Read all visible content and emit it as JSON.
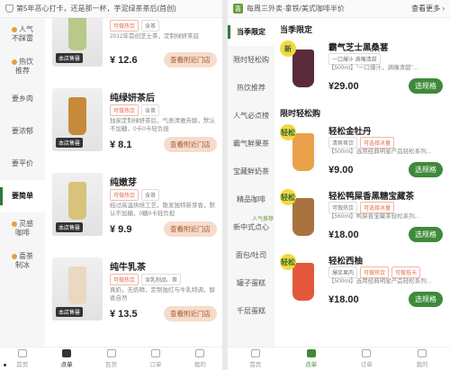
{
  "left": {
    "banner_text": "第5年恶心打卡，还是那一杯，芋泥绿茶茶后(首创)",
    "sidebar": [
      {
        "label": "人气\n不踩雷",
        "active": false,
        "dot": true
      },
      {
        "label": "热饮\n推荐",
        "active": false,
        "dot": true
      },
      {
        "label": "要乡肉",
        "active": false
      },
      {
        "label": "要浓郁",
        "active": false
      },
      {
        "label": "要平价",
        "active": false
      },
      {
        "label": "要简单",
        "active": true
      },
      {
        "label": "灵感\n咖啡",
        "active": false,
        "dot": true
      },
      {
        "label": "喜茶\n制冰",
        "active": false,
        "dot": true
      }
    ],
    "items": [
      {
        "name": "芝芝绿妍茶后(首创)",
        "tags": [
          "可做热饮",
          "含茶"
        ],
        "desc": "2012年首创芝士茶，定制绿妍茶底",
        "price": "¥ 12.6",
        "button": "查看附近门店",
        "store_tag": "本店售罄",
        "cup_color": "#b9c98a"
      },
      {
        "name": "纯绿妍茶后",
        "tags": [
          "可做热饮",
          "含茶"
        ],
        "desc": "独家定制绿妍茶后，气质清雅芳醇，默认不加糖，0卡0卡轻负担",
        "price": "¥ 8.1",
        "button": "查看附近门店",
        "store_tag": "本店售罄",
        "cup_color": "#c78a3a"
      },
      {
        "name": "纯嫩芽",
        "tags": [
          "可做热饮",
          "含茶"
        ],
        "desc": "经过高温烘焙工艺，散发独特新芽香，默认不加糖，0糖0卡轻负担",
        "price": "¥ 9.9",
        "button": "查看附近门店",
        "store_tag": "本店售罄",
        "cup_color": "#d9c27a"
      },
      {
        "name": "纯牛乳茶",
        "tags": [
          "可做热饮",
          "含乳制品、茶"
        ],
        "desc": "真奶，无奶精，定制独红与牛乳特调，醇香自然",
        "price": "¥ 13.5",
        "button": "查看附近门店",
        "store_tag": "本店售罄",
        "cup_color": "#e8d9c0"
      }
    ],
    "tabbar": [
      {
        "label": "首页",
        "active": false
      },
      {
        "label": "点单",
        "active": true
      },
      {
        "label": "百货",
        "active": false
      },
      {
        "label": "订单",
        "active": false
      },
      {
        "label": "我的",
        "active": false
      }
    ]
  },
  "right": {
    "banner_logo": "喜",
    "banner_text": "每周三外卖·拿铁/美式咖啡半价",
    "banner_more": "查看更多 ›",
    "sidebar": [
      {
        "label": "当季限定",
        "active": true
      },
      {
        "label": "限时轻松购",
        "active": false
      },
      {
        "label": "热饮推荐",
        "active": false
      },
      {
        "label": "人气必点榜",
        "active": false
      },
      {
        "label": "霸气鲜果茶",
        "active": false
      },
      {
        "label": "宝藏鲜奶茶",
        "active": false
      },
      {
        "label": "精品咖啡",
        "active": false
      },
      {
        "label": "新中式点心",
        "active": false,
        "tag": "人气推荐"
      },
      {
        "label": "面包/吐司",
        "active": false
      },
      {
        "label": "罐子蛋糕",
        "active": false
      },
      {
        "label": "千层蛋糕",
        "active": false
      }
    ],
    "sections": [
      {
        "title": "当季限定",
        "items": [
          {
            "name": "霸气芝士黑桑葚",
            "badge": "新",
            "tags": [
              "一口爆汁 满嘴清甜"
            ],
            "desc": "【500ml】\"一口爆汁，满嘴清甜\"...",
            "price": "¥29.00",
            "button": "选规格",
            "glass_color": "#5a2a3a"
          }
        ]
      },
      {
        "title": "限时轻松购",
        "items": [
          {
            "name": "轻松金牡丹",
            "badge": "轻松",
            "tags": [
              "清爽茶饮",
              "可选择冰量"
            ],
            "desc": "【500ml】选用经典明星产品轻松系列...",
            "price": "¥9.00",
            "button": "选规格",
            "glass_color": "#e9a24a"
          },
          {
            "name": "轻松鸭屎香黑糖宝藏茶",
            "badge": "轻松",
            "tags": [
              "可做热饮",
              "可选择冰量"
            ],
            "desc": "【560ml】鸭屎香宝藏茶轻松系列...",
            "price": "¥18.00",
            "button": "选规格",
            "glass_color": "#a8733f"
          },
          {
            "name": "轻松西柚",
            "badge": "轻松",
            "tags": [
              "爆浆果肉",
              "可做热饮",
              "可做低卡"
            ],
            "desc": "【500ml】选用经典明星产品轻松系列...",
            "price": "¥18.00",
            "button": "选规格",
            "glass_color": "#e4573a"
          }
        ]
      }
    ],
    "tabbar": [
      {
        "label": "首页",
        "active": false
      },
      {
        "label": "点单",
        "active": true
      },
      {
        "label": "订单",
        "active": false
      },
      {
        "label": "我的",
        "active": false
      }
    ]
  }
}
